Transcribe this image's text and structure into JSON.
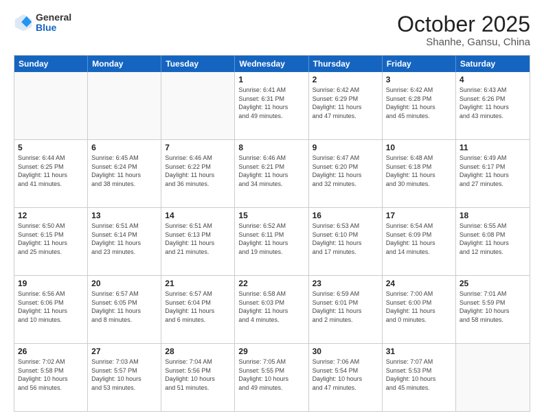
{
  "header": {
    "logo_general": "General",
    "logo_blue": "Blue",
    "month": "October 2025",
    "location": "Shanhe, Gansu, China"
  },
  "weekdays": [
    "Sunday",
    "Monday",
    "Tuesday",
    "Wednesday",
    "Thursday",
    "Friday",
    "Saturday"
  ],
  "rows": [
    [
      {
        "day": "",
        "info": ""
      },
      {
        "day": "",
        "info": ""
      },
      {
        "day": "",
        "info": ""
      },
      {
        "day": "1",
        "info": "Sunrise: 6:41 AM\nSunset: 6:31 PM\nDaylight: 11 hours\nand 49 minutes."
      },
      {
        "day": "2",
        "info": "Sunrise: 6:42 AM\nSunset: 6:29 PM\nDaylight: 11 hours\nand 47 minutes."
      },
      {
        "day": "3",
        "info": "Sunrise: 6:42 AM\nSunset: 6:28 PM\nDaylight: 11 hours\nand 45 minutes."
      },
      {
        "day": "4",
        "info": "Sunrise: 6:43 AM\nSunset: 6:26 PM\nDaylight: 11 hours\nand 43 minutes."
      }
    ],
    [
      {
        "day": "5",
        "info": "Sunrise: 6:44 AM\nSunset: 6:25 PM\nDaylight: 11 hours\nand 41 minutes."
      },
      {
        "day": "6",
        "info": "Sunrise: 6:45 AM\nSunset: 6:24 PM\nDaylight: 11 hours\nand 38 minutes."
      },
      {
        "day": "7",
        "info": "Sunrise: 6:46 AM\nSunset: 6:22 PM\nDaylight: 11 hours\nand 36 minutes."
      },
      {
        "day": "8",
        "info": "Sunrise: 6:46 AM\nSunset: 6:21 PM\nDaylight: 11 hours\nand 34 minutes."
      },
      {
        "day": "9",
        "info": "Sunrise: 6:47 AM\nSunset: 6:20 PM\nDaylight: 11 hours\nand 32 minutes."
      },
      {
        "day": "10",
        "info": "Sunrise: 6:48 AM\nSunset: 6:18 PM\nDaylight: 11 hours\nand 30 minutes."
      },
      {
        "day": "11",
        "info": "Sunrise: 6:49 AM\nSunset: 6:17 PM\nDaylight: 11 hours\nand 27 minutes."
      }
    ],
    [
      {
        "day": "12",
        "info": "Sunrise: 6:50 AM\nSunset: 6:15 PM\nDaylight: 11 hours\nand 25 minutes."
      },
      {
        "day": "13",
        "info": "Sunrise: 6:51 AM\nSunset: 6:14 PM\nDaylight: 11 hours\nand 23 minutes."
      },
      {
        "day": "14",
        "info": "Sunrise: 6:51 AM\nSunset: 6:13 PM\nDaylight: 11 hours\nand 21 minutes."
      },
      {
        "day": "15",
        "info": "Sunrise: 6:52 AM\nSunset: 6:11 PM\nDaylight: 11 hours\nand 19 minutes."
      },
      {
        "day": "16",
        "info": "Sunrise: 6:53 AM\nSunset: 6:10 PM\nDaylight: 11 hours\nand 17 minutes."
      },
      {
        "day": "17",
        "info": "Sunrise: 6:54 AM\nSunset: 6:09 PM\nDaylight: 11 hours\nand 14 minutes."
      },
      {
        "day": "18",
        "info": "Sunrise: 6:55 AM\nSunset: 6:08 PM\nDaylight: 11 hours\nand 12 minutes."
      }
    ],
    [
      {
        "day": "19",
        "info": "Sunrise: 6:56 AM\nSunset: 6:06 PM\nDaylight: 11 hours\nand 10 minutes."
      },
      {
        "day": "20",
        "info": "Sunrise: 6:57 AM\nSunset: 6:05 PM\nDaylight: 11 hours\nand 8 minutes."
      },
      {
        "day": "21",
        "info": "Sunrise: 6:57 AM\nSunset: 6:04 PM\nDaylight: 11 hours\nand 6 minutes."
      },
      {
        "day": "22",
        "info": "Sunrise: 6:58 AM\nSunset: 6:03 PM\nDaylight: 11 hours\nand 4 minutes."
      },
      {
        "day": "23",
        "info": "Sunrise: 6:59 AM\nSunset: 6:01 PM\nDaylight: 11 hours\nand 2 minutes."
      },
      {
        "day": "24",
        "info": "Sunrise: 7:00 AM\nSunset: 6:00 PM\nDaylight: 11 hours\nand 0 minutes."
      },
      {
        "day": "25",
        "info": "Sunrise: 7:01 AM\nSunset: 5:59 PM\nDaylight: 10 hours\nand 58 minutes."
      }
    ],
    [
      {
        "day": "26",
        "info": "Sunrise: 7:02 AM\nSunset: 5:58 PM\nDaylight: 10 hours\nand 56 minutes."
      },
      {
        "day": "27",
        "info": "Sunrise: 7:03 AM\nSunset: 5:57 PM\nDaylight: 10 hours\nand 53 minutes."
      },
      {
        "day": "28",
        "info": "Sunrise: 7:04 AM\nSunset: 5:56 PM\nDaylight: 10 hours\nand 51 minutes."
      },
      {
        "day": "29",
        "info": "Sunrise: 7:05 AM\nSunset: 5:55 PM\nDaylight: 10 hours\nand 49 minutes."
      },
      {
        "day": "30",
        "info": "Sunrise: 7:06 AM\nSunset: 5:54 PM\nDaylight: 10 hours\nand 47 minutes."
      },
      {
        "day": "31",
        "info": "Sunrise: 7:07 AM\nSunset: 5:53 PM\nDaylight: 10 hours\nand 45 minutes."
      },
      {
        "day": "",
        "info": ""
      }
    ]
  ]
}
